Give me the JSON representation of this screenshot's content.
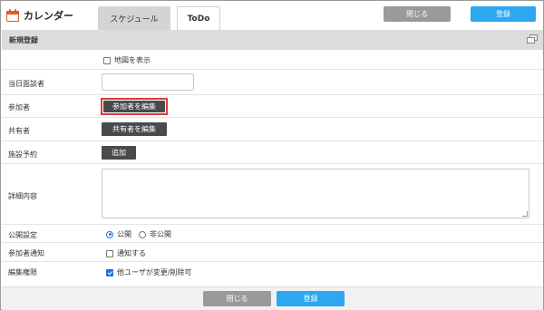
{
  "header": {
    "app_title": "カレンダー",
    "app_icon": "calendar-icon",
    "tabs": [
      {
        "label": "スケジュール",
        "active": true
      },
      {
        "label": "ToDo",
        "active": false
      }
    ],
    "close_label": "閉じる",
    "save_label": "登録"
  },
  "section": {
    "title": "新規登録"
  },
  "form": {
    "show_map": {
      "label": "地図を表示",
      "checked": false
    },
    "contact_person": {
      "label": "当日面談者",
      "value": ""
    },
    "participants": {
      "label": "参加者",
      "button": "参加者を編集"
    },
    "sharers": {
      "label": "共有者",
      "button": "共有者を編集"
    },
    "facility": {
      "label": "施設予約",
      "button": "追加"
    },
    "details": {
      "label": "詳細内容",
      "value": ""
    },
    "visibility": {
      "label": "公開設定",
      "options": [
        "公開",
        "非公開"
      ],
      "selected": "公開"
    },
    "notify": {
      "label": "参加者通知",
      "option": "通知する",
      "checked": false
    },
    "edit_permission": {
      "label": "編集権限",
      "option": "他ユーザが変更/削除可",
      "checked": true
    }
  },
  "footer": {
    "close_label": "閉じる",
    "save_label": "登録"
  },
  "colors": {
    "save_button": "#2da7f0",
    "close_button": "#9a9a9a",
    "highlight_border": "#e03a3a",
    "dark_button": "#4a4a4a"
  }
}
